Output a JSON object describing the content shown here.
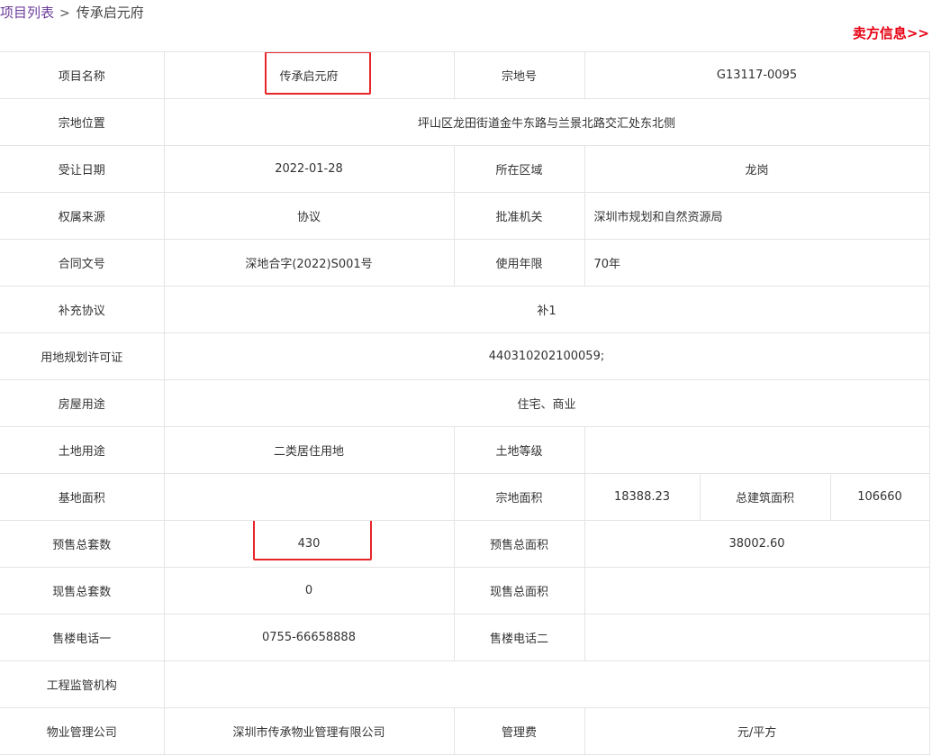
{
  "breadcrumb": {
    "parent": "项目列表",
    "separator": ">",
    "current": "传承启元府"
  },
  "seller_link": "卖方信息>>",
  "colors": {
    "highlight_box": "#e8262a",
    "link_red": "#e60012",
    "breadcrumb_link": "#6b3d99",
    "border": "#e4e4e4"
  },
  "rows": {
    "project_name": {
      "label": "项目名称",
      "value": "传承启元府",
      "highlighted": true
    },
    "parcel_no": {
      "label": "宗地号",
      "value": "G13117-0095"
    },
    "parcel_location": {
      "label": "宗地位置",
      "value": "坪山区龙田街道金牛东路与兰景北路交汇处东北侧"
    },
    "transfer_date": {
      "label": "受让日期",
      "value": "2022-01-28"
    },
    "district": {
      "label": "所在区域",
      "value": "龙岗"
    },
    "ownership_source": {
      "label": "权属来源",
      "value": "协议"
    },
    "approval_authority": {
      "label": "批准机关",
      "value": "深圳市规划和自然资源局"
    },
    "contract_no": {
      "label": "合同文号",
      "value": "深地合字(2022)S001号"
    },
    "use_term": {
      "label": "使用年限",
      "value": "70年"
    },
    "supplement": {
      "label": "补充协议",
      "value": "补1"
    },
    "planning_permit": {
      "label": "用地规划许可证",
      "value": "440310202100059;"
    },
    "building_use": {
      "label": "房屋用途",
      "value": "住宅、商业"
    },
    "land_use": {
      "label": "土地用途",
      "value": "二类居住用地"
    },
    "land_grade": {
      "label": "土地等级",
      "value": ""
    },
    "base_area": {
      "label": "基地面积",
      "value": ""
    },
    "parcel_area": {
      "label": "宗地面积",
      "value": "18388.23"
    },
    "total_floor_area": {
      "label": "总建筑面积",
      "value": "106660"
    },
    "presale_units": {
      "label": "预售总套数",
      "value": "430",
      "highlighted": true
    },
    "presale_area": {
      "label": "预售总面积",
      "value": "38002.60"
    },
    "current_units": {
      "label": "现售总套数",
      "value": "0"
    },
    "current_area": {
      "label": "现售总面积",
      "value": ""
    },
    "phone1": {
      "label": "售楼电话一",
      "value": "0755-66658888"
    },
    "phone2": {
      "label": "售楼电话二",
      "value": ""
    },
    "supervisor": {
      "label": "工程监管机构",
      "value": ""
    },
    "property_mgmt": {
      "label": "物业管理公司",
      "value": "深圳市传承物业管理有限公司"
    },
    "mgmt_fee": {
      "label": "管理费",
      "value": "元/平方"
    }
  }
}
